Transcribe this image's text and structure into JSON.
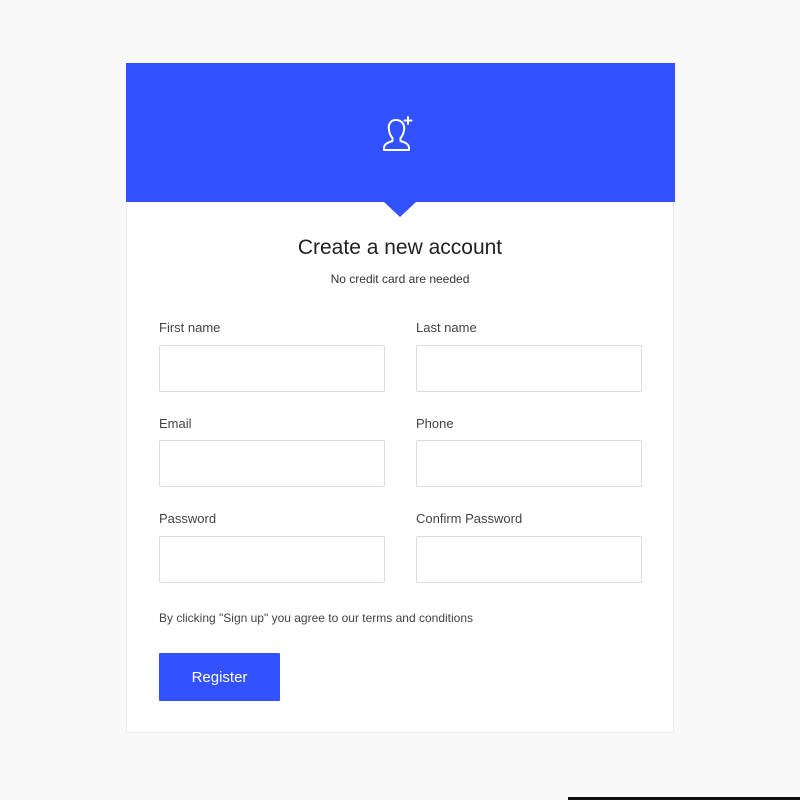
{
  "colors": {
    "accent": "#3352ff",
    "background": "#f9f9f9",
    "card": "#ffffff"
  },
  "header": {
    "icon": "user-plus-icon"
  },
  "form": {
    "title": "Create a new account",
    "subtitle": "No credit card are needed",
    "fields": {
      "first_name": {
        "label": "First name",
        "value": "",
        "placeholder": ""
      },
      "last_name": {
        "label": "Last name",
        "value": "",
        "placeholder": ""
      },
      "email": {
        "label": "Email",
        "value": "",
        "placeholder": ""
      },
      "phone": {
        "label": "Phone",
        "value": "",
        "placeholder": ""
      },
      "password": {
        "label": "Password",
        "value": "",
        "placeholder": ""
      },
      "confirm_password": {
        "label": "Confirm Password",
        "value": "",
        "placeholder": ""
      }
    },
    "terms": "By clicking \"Sign up\" you agree to our terms and conditions",
    "submit_label": "Register"
  }
}
